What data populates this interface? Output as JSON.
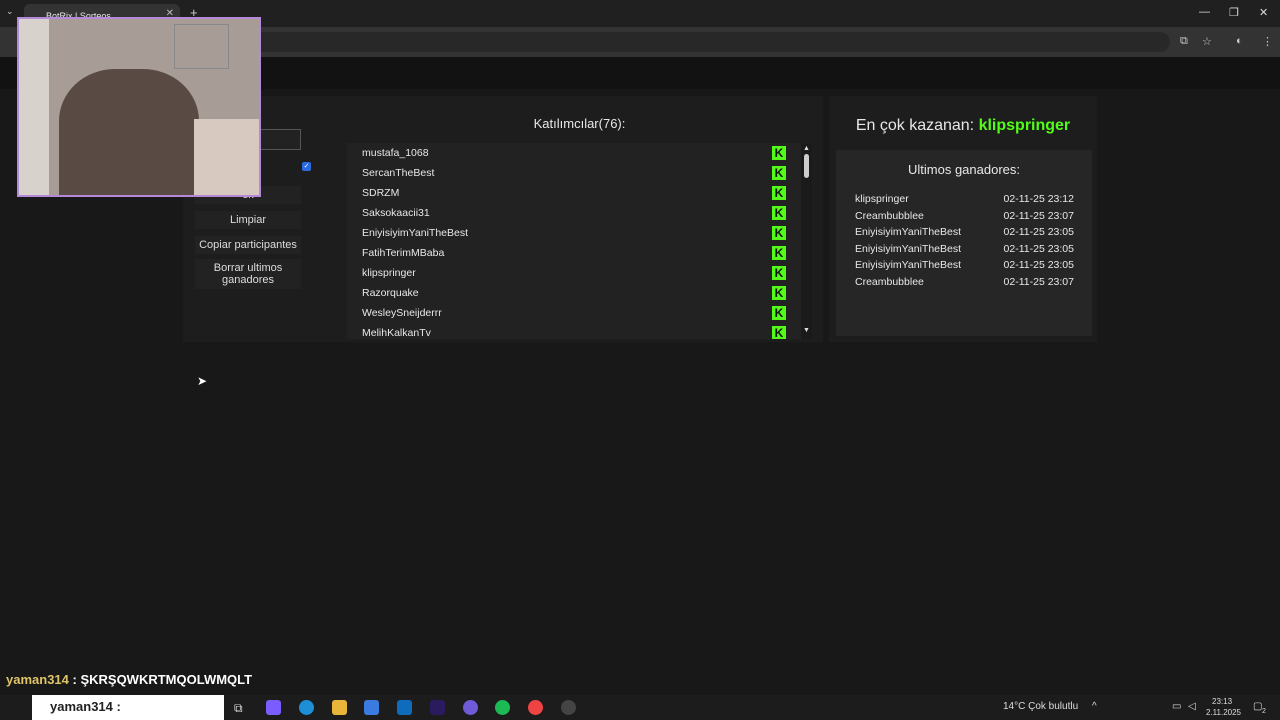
{
  "browser": {
    "tab_title": "BotRix | Sorteos",
    "tab_close": "✕",
    "new_tab": "+",
    "tab_menu": "⌄",
    "window_controls": [
      "—",
      "❐",
      "✕"
    ]
  },
  "sidebar": {
    "buttons": [
      {
        "label": "ek"
      },
      {
        "label": "Limpiar"
      },
      {
        "label": "Copiar participantes"
      },
      {
        "label": "Borrar ultimos ganadores"
      }
    ]
  },
  "participants": {
    "title": "Katılımcılar(76):",
    "kick_glyph": "K",
    "list": [
      "mustafa_1068",
      "SercanTheBest",
      "SDRZM",
      "Saksokaacii31",
      "EniyisiyimYaniTheBest",
      "FatihTerimMBaba",
      "klipspringer",
      "Razorquake",
      "WesleySneijderrr",
      "MelihKalkanTv"
    ]
  },
  "winners": {
    "top_prefix": "En çok kazanan:",
    "top_name": "klipspringer",
    "title": "Ultimos ganadores:",
    "rows": [
      {
        "name": "klipspringer",
        "time": "02-11-25 23:12"
      },
      {
        "name": "Creambubblee",
        "time": "02-11-25 23:07"
      },
      {
        "name": "EniyisiyimYaniTheBest",
        "time": "02-11-25 23:05"
      },
      {
        "name": "EniyisiyimYaniTheBest",
        "time": "02-11-25 23:05"
      },
      {
        "name": "EniyisiyimYaniTheBest",
        "time": "02-11-25 23:05"
      },
      {
        "name": "Creambubblee",
        "time": "02-11-25 23:07"
      }
    ]
  },
  "chat": {
    "user": "yaman314",
    "message": ": ŞKRŞQWKRTMQOLWMQLT"
  },
  "taskbar": {
    "search_text": "yaman314 :",
    "weather": "14°C  Çok bulutlu",
    "time": "23:13",
    "date": "2.11.2025",
    "notif_count": "2"
  },
  "colors": {
    "kick_green": "#53fc18",
    "accent_blue": "#2a6ae0",
    "webcam_border": "#b48ad8"
  }
}
